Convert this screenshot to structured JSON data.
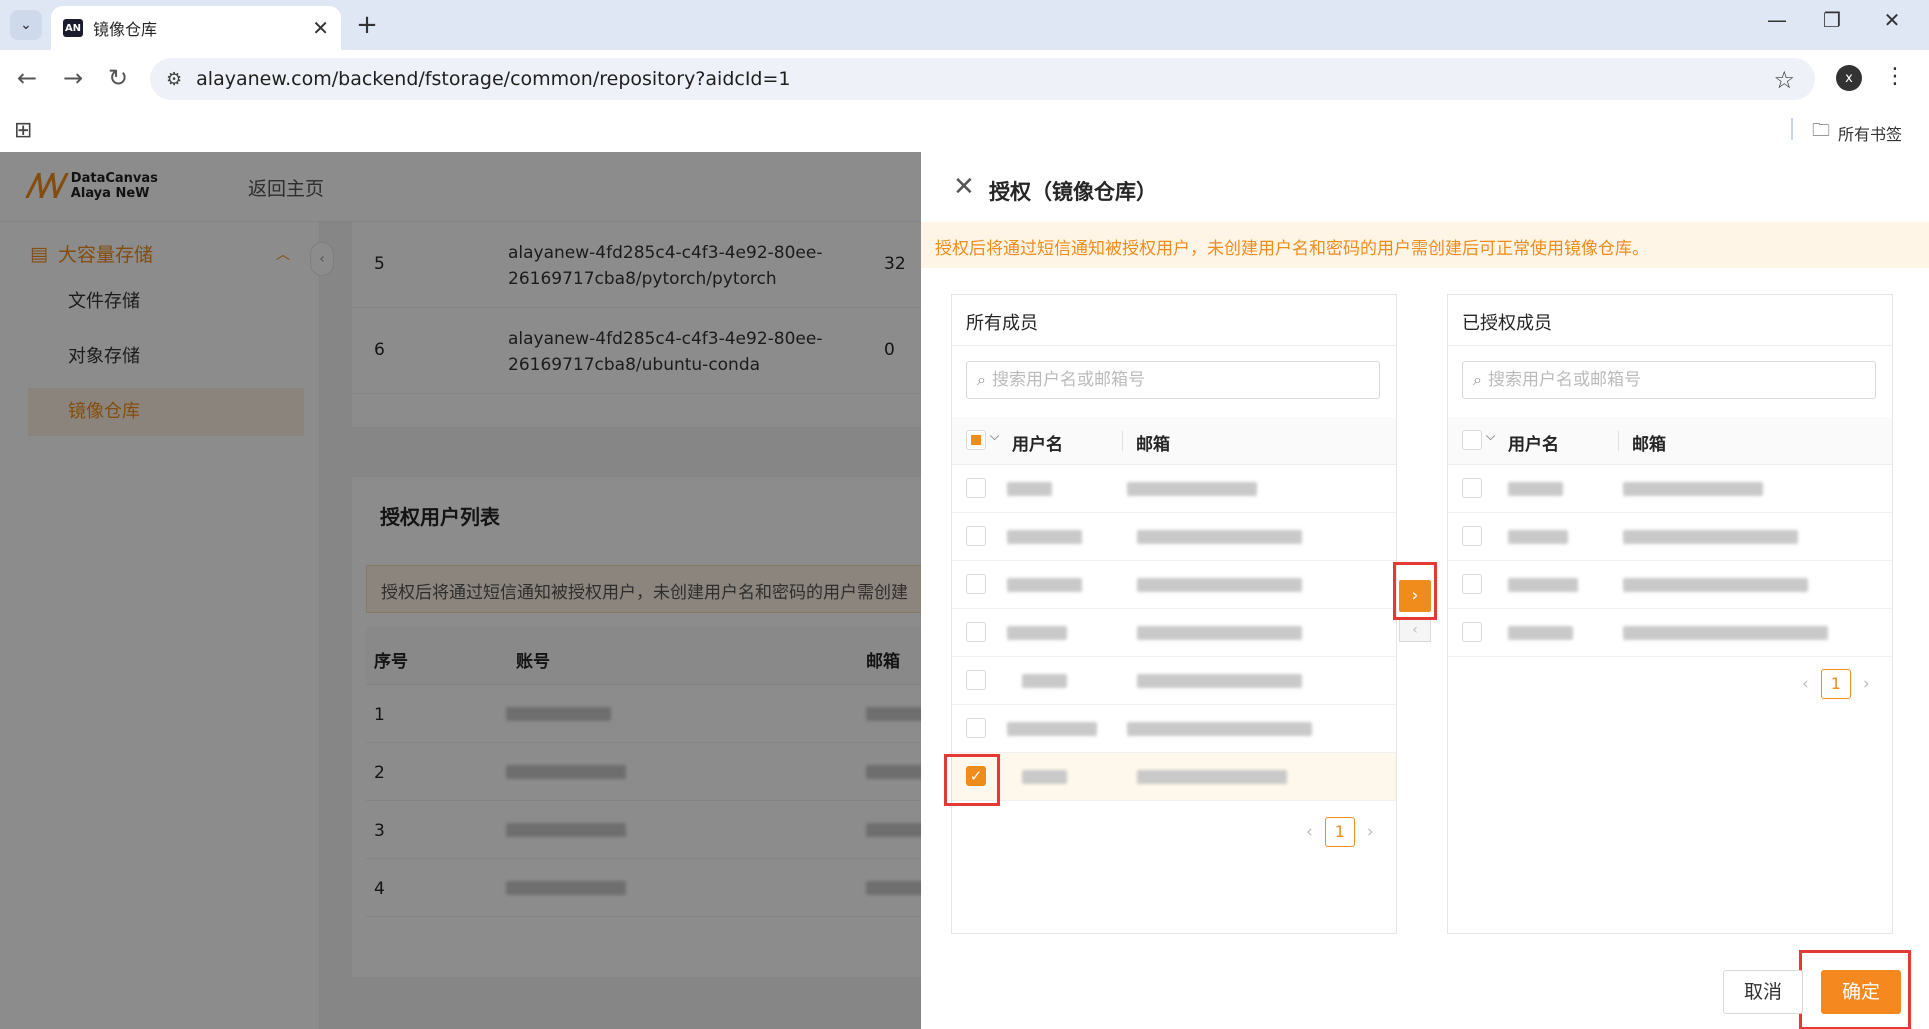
{
  "browser": {
    "tab_title": "镜像仓库",
    "tab_favicon": "AN",
    "url": "alayanew.com/backend/fstorage/common/repository?aidcId=1",
    "profile_initial": "x",
    "bookmarks_all": "所有书签"
  },
  "app": {
    "logo_line1": "DataCanvas",
    "logo_line2": "Alaya NeW",
    "back_home": "返回主页"
  },
  "sidebar": {
    "group_label": "大容量存储",
    "items": [
      {
        "label": "文件存储"
      },
      {
        "label": "对象存储"
      },
      {
        "label": "镜像仓库"
      }
    ]
  },
  "repos": [
    {
      "idx": "5",
      "name": "alayanew-4fd285c4-c4f3-4e92-80ee-26169717cba8/pytorch/pytorch",
      "count": "32"
    },
    {
      "idx": "6",
      "name": "alayanew-4fd285c4-c4f3-4e92-80ee-26169717cba8/ubuntu-conda",
      "count": "0"
    }
  ],
  "auth_list": {
    "title": "授权用户列表",
    "notice": "授权后将通过短信通知被授权用户，未创建用户名和密码的用户需创建",
    "col_index": "序号",
    "col_account": "账号",
    "col_email": "邮箱",
    "rows": [
      {
        "i": "1"
      },
      {
        "i": "2"
      },
      {
        "i": "3"
      },
      {
        "i": "4"
      }
    ]
  },
  "drawer": {
    "title": "授权（镜像仓库）",
    "notice": "授权后将通过短信通知被授权用户，未创建用户名和密码的用户需创建后可正常使用镜像仓库。",
    "left": {
      "title": "所有成员",
      "search_placeholder": "搜索用户名或邮箱号",
      "col_user": "用户名",
      "col_email": "邮箱",
      "page": "1"
    },
    "right": {
      "title": "已授权成员",
      "search_placeholder": "搜索用户名或邮箱号",
      "col_user": "用户名",
      "col_email": "邮箱",
      "page": "1"
    },
    "cancel": "取消",
    "confirm": "确定"
  },
  "colors": {
    "accent": "#f08c1c",
    "highlight": "#e53935"
  }
}
